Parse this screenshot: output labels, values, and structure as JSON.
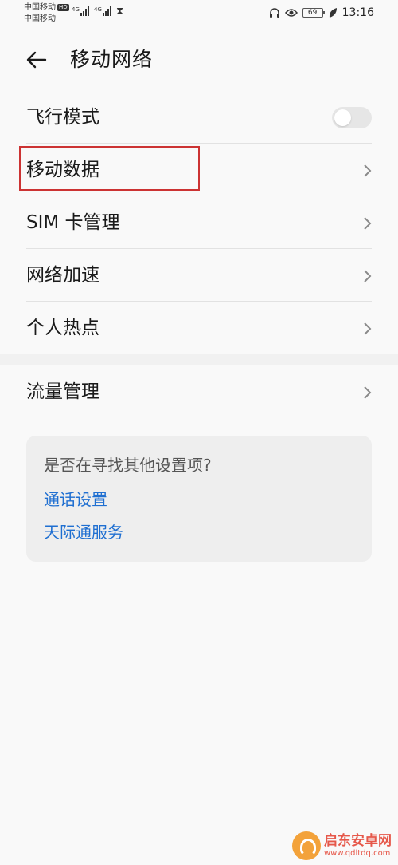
{
  "status_bar": {
    "carrier_1": "中国移动",
    "carrier_1_badge": "HD",
    "carrier_2": "中国移动",
    "signal_1_tag": "4G",
    "signal_2_tag": "4G",
    "battery": "69",
    "time": "13:16"
  },
  "header": {
    "title": "移动网络"
  },
  "settings": {
    "airplane_mode": {
      "label": "飞行模式",
      "enabled": false
    },
    "items": [
      {
        "label": "移动数据"
      },
      {
        "label": "SIM 卡管理"
      },
      {
        "label": "网络加速"
      },
      {
        "label": "个人热点"
      }
    ],
    "traffic": {
      "label": "流量管理"
    }
  },
  "suggestions": {
    "title": "是否在寻找其他设置项?",
    "links": [
      "通话设置",
      "天际通服务"
    ]
  },
  "watermark": {
    "name": "启东安卓网",
    "url": "www.qdltdq.com"
  },
  "colors": {
    "accent_link": "#1f6fd1",
    "highlight_box": "#cc3333",
    "background": "#f9f9f9"
  }
}
